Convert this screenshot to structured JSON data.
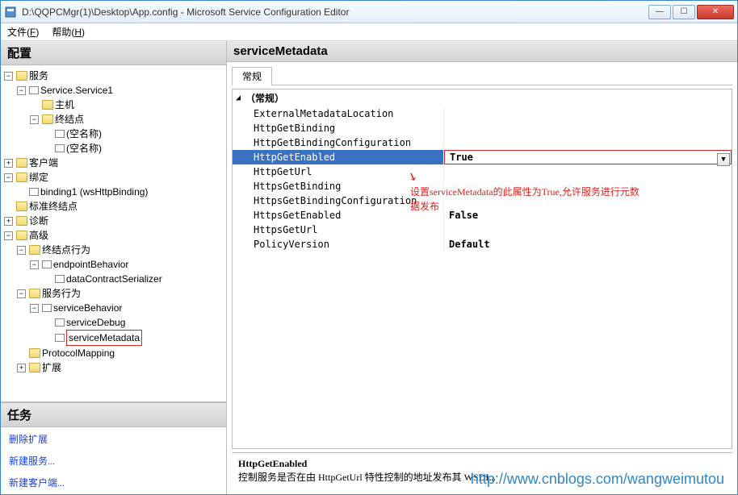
{
  "window": {
    "title": "D:\\QQPCMgr(1)\\Desktop\\App.config - Microsoft Service Configuration Editor"
  },
  "menu": {
    "file": "文件",
    "file_u": "F",
    "help": "帮助",
    "help_u": "H"
  },
  "left": {
    "config_header": "配置",
    "tasks_header": "任务",
    "tree": {
      "services": "服务",
      "service1": "Service.Service1",
      "host": "主机",
      "endpoints": "终结点",
      "empty_name": "(空名称)",
      "client": "客户端",
      "bindings": "绑定",
      "binding1": "binding1 (wsHttpBinding)",
      "std_endpoints": "标准终结点",
      "diagnostics": "诊断",
      "advanced": "高级",
      "endpoint_behaviors": "终结点行为",
      "endpoint_behavior": "endpointBehavior",
      "data_contract_serializer": "dataContractSerializer",
      "service_behaviors": "服务行为",
      "service_behavior": "serviceBehavior",
      "service_debug": "serviceDebug",
      "service_metadata": "serviceMetadata",
      "protocol_mapping": "ProtocolMapping",
      "extensions": "扩展"
    },
    "tasks": {
      "delete_ext": "删除扩展",
      "new_service": "新建服务...",
      "new_client": "新建客户端..."
    }
  },
  "right": {
    "header": "serviceMetadata",
    "tab": "常规",
    "category": "（常规）",
    "props": {
      "ExternalMetadataLocation": "",
      "HttpGetBinding": "",
      "HttpGetBindingConfiguration": "",
      "HttpGetEnabled": "True",
      "HttpGetUrl": "",
      "HttpsGetBinding": "",
      "HttpsGetBindingConfiguration": "",
      "HttpsGetEnabled": "False",
      "HttpsGetUrl": "",
      "PolicyVersion": "Default"
    },
    "annotation_l1": "设置serviceMetadata的此属性为True,允许服务进行元数",
    "annotation_l2": "据发布",
    "desc_name": "HttpGetEnabled",
    "desc_text": "控制服务是否在由 HttpGetUrl 特性控制的地址发布其 WSDL。",
    "watermark": "http://www.cnblogs.com/wangweimutou"
  }
}
